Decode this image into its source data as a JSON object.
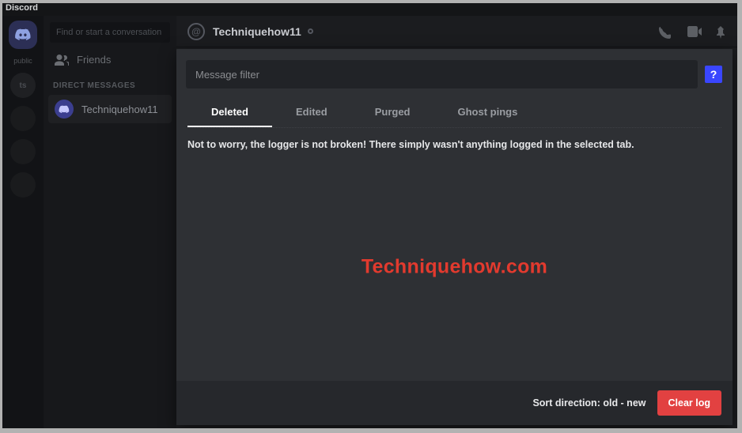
{
  "titlebar": "Discord",
  "servers": {
    "public_label": "public",
    "circle_label": "ts"
  },
  "dm": {
    "search_placeholder": "Find or start a conversation",
    "friends_label": "Friends",
    "section_label": "DIRECT MESSAGES",
    "items": [
      {
        "name": "Techniquehow11"
      }
    ]
  },
  "channel": {
    "name": "Techniquehow11"
  },
  "logger": {
    "filter_placeholder": "Message filter",
    "help_label": "?",
    "tabs": [
      {
        "label": "Deleted",
        "active": true
      },
      {
        "label": "Edited",
        "active": false
      },
      {
        "label": "Purged",
        "active": false
      },
      {
        "label": "Ghost pings",
        "active": false
      }
    ],
    "empty_message": "Not to worry, the logger is not broken! There simply wasn't anything logged in the selected tab.",
    "sort_text": "Sort direction: old - new",
    "clear_label": "Clear log"
  },
  "watermark": "Techniquehow.com"
}
